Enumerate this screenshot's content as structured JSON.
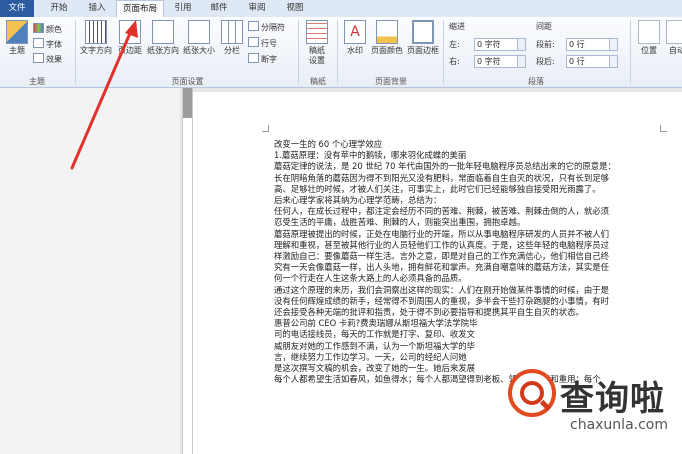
{
  "tabs": [
    {
      "label": "文件",
      "active": false,
      "file": true
    },
    {
      "label": "开始",
      "active": false
    },
    {
      "label": "插入",
      "active": false
    },
    {
      "label": "页面布局",
      "active": true
    },
    {
      "label": "引用",
      "active": false
    },
    {
      "label": "邮件",
      "active": false
    },
    {
      "label": "审阅",
      "active": false
    },
    {
      "label": "视图",
      "active": false
    }
  ],
  "ribbon": {
    "theme": {
      "themes": "主题",
      "colors": "颜色",
      "fonts": "字体",
      "effects": "效果",
      "group": "主题"
    },
    "page_setup": {
      "text_direction": "文字方向",
      "margins": "页边距",
      "orientation": "纸张方向",
      "size": "纸张大小",
      "columns": "分栏",
      "breaks": "分隔符",
      "line_numbers": "行号",
      "hyphenation": "断字",
      "group": "页面设置"
    },
    "draft": {
      "paper": "稿纸设置",
      "group": "稿纸"
    },
    "background": {
      "watermark": "水印",
      "page_color": "页面颜色",
      "page_borders": "页面边框",
      "group": "页面背景"
    },
    "paragraph": {
      "indent": "缩进",
      "left": "左:",
      "left_value": "0 字符",
      "right": "右:",
      "right_value": "0 字符",
      "spacing": "间距",
      "before": "段前:",
      "before_value": "0 行",
      "after": "段后:",
      "after_value": "0 行",
      "group": "段落"
    },
    "arrange": {
      "position": "位置",
      "wrap": "自动"
    }
  },
  "document": {
    "lines": [
      "改变一生的 60 个心理学效应",
      "1.蘑菇原理：没有苹中的鹅犊，哪来羽化成蝶的美丽",
      "蘑菇定律的说法，是 20 世纪 70 年代由国外的一批年轻电脑程序员总结出来的它的原意是：",
      "长在阴暗角落的蘑菇因为得不到阳光又没有肥料，常面临着自生自灭的状况，只有长到足够",
      "高、足够壮的时候，才被人们关注，可事实上，此时它们已经能够独自接受阳光雨露了。",
      "后来心理学家将其纳为心理学范畴，总结为：",
      "任何人，在成长过程中，都注定会经历不同的苦难、荆棘，被苦难、荆棘击倒的人，就必须",
      "忍受生活的平庸，战胜苦难、荆棘的人，则能突出重围，拥抱卓越。",
      "蘑菇原理被提出的时候，正处在电脑行业的开端，所以从事电脑程序研发的人员并不被人们",
      "理解和重视，甚至被其他行业的人员轻他们工作的认真度。于是，这些年轻的电脑程序员过",
      "样激励自己：要像蘑菇一样生活。言外之意，即是对自己的工作充满信心，他们相信自己终",
      "究有一天会像蘑菇一样，出人头地，拥有鲜花和掌声。充满自嘲意味的蘑菇方法，其实是任",
      "何一个行走在人生这条大路上的人必须具备的品质。",
      "通过这个原理的来历，我们会洞察出这样的现实：人们在刚开始做某件事情的时候，由于是",
      "没有任何辉煌成绩的新手，经常得不到周围人的重视，多半会干些打杂跑腿的小事情，有时",
      "还会接受各种无端的批评和指责，处于得不到必要指导和提携其平自生自灭的状态。",
      "惠普公司前 CEO 卡莉?费奥瑞娜从斯坦福大学法学院毕",
      "司的电话接线员，每天的工作就是打字、复印、收发文",
      "威朋友对她的工作感到不满，认为一个斯坦福大学的毕",
      "言，继续努力工作边学习。一天，公司的经纪人问她",
      "是这次撰写文稿的机会，改变了她的一生。她后来发展",
      "每个人都希望生活如春风，如鱼得水；每个人都渴望得到老板、领导的赏识和重用；每个"
    ]
  },
  "watermark": {
    "cn": "查询啦",
    "en": "chaxunla.com"
  },
  "colors": {
    "file_tab": "#2a5c9f",
    "arrow": "#e0312b",
    "brand": "#e04b1f"
  }
}
